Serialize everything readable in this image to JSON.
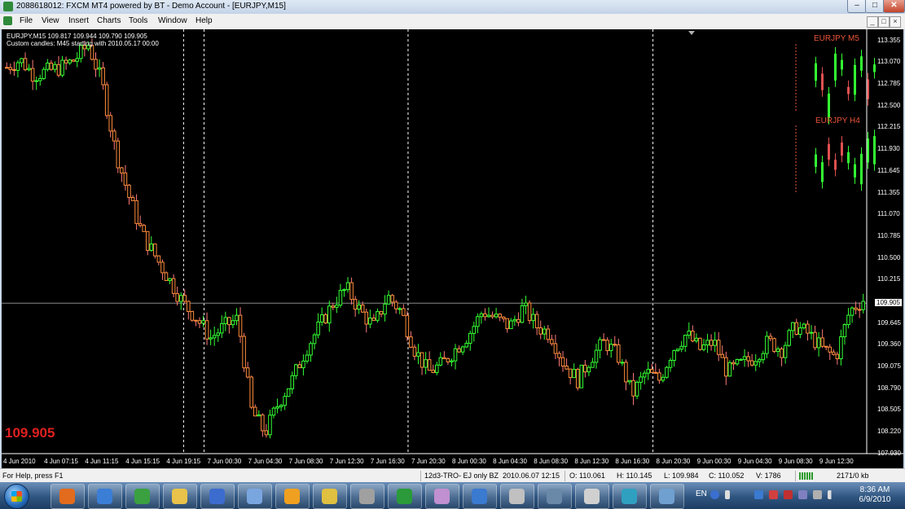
{
  "window": {
    "title": "2088618012: FXCM MT4 powered by BT - Demo Account - [EURJPY,M15]",
    "minimize": "–",
    "maximize": "□",
    "close": "✕"
  },
  "menu": [
    "File",
    "View",
    "Insert",
    "Charts",
    "Tools",
    "Window",
    "Help"
  ],
  "mdi_buttons": [
    "_",
    "□",
    "×"
  ],
  "chart": {
    "header_line1": "EURJPY,M15  109.817 109.944 109.790 109.905",
    "header_line2": "Custom candles: M45 starting with 2010.05.17 00:00",
    "big_price": "109.905",
    "current_price": "109.905",
    "price_levels": [
      "113.355",
      "113.070",
      "112.785",
      "112.500",
      "112.215",
      "111.930",
      "111.645",
      "111.355",
      "111.070",
      "110.785",
      "110.500",
      "110.215",
      "109.645",
      "109.360",
      "109.075",
      "108.790",
      "108.505",
      "108.220",
      "107.930"
    ],
    "time_labels": [
      "4 Jun 2010",
      "4 Jun 07:15",
      "4 Jun 11:15",
      "4 Jun 15:15",
      "4 Jun 19:15",
      "7 Jun 00:30",
      "7 Jun 04:30",
      "7 Jun 08:30",
      "7 Jun 12:30",
      "7 Jun 16:30",
      "7 Jun 20:30",
      "8 Jun 00:30",
      "8 Jun 04:30",
      "8 Jun 08:30",
      "8 Jun 12:30",
      "8 Jun 16:30",
      "8 Jun 20:30",
      "9 Jun 00:30",
      "9 Jun 04:30",
      "9 Jun 08:30",
      "9 Jun 12:30"
    ],
    "mini_m5_label": "EURJPY  M5",
    "mini_h4_label": "EURJPY  H4",
    "colors": {
      "bull": "#33ff33",
      "bear": "#ff7a7a",
      "bear_outline": "#ff8c3a",
      "grid": "#ffffff",
      "price_line": "#8a8a8a"
    }
  },
  "chart_data": {
    "type": "candlestick",
    "symbol": "EURJPY",
    "timeframe": "M15",
    "ylim": [
      107.93,
      113.5
    ],
    "current": 109.905,
    "session_breaks": [
      "4 Jun 19:15",
      "7 Jun 00:30",
      "7 Jun 20:30",
      "8 Jun 20:30"
    ],
    "close_path": [
      113.0,
      113.1,
      112.9,
      112.95,
      113.0,
      113.1,
      113.3,
      112.8,
      111.9,
      111.3,
      110.8,
      110.5,
      110.2,
      109.9,
      109.7,
      109.45,
      109.6,
      109.7,
      108.5,
      108.2,
      108.6,
      108.9,
      109.3,
      109.6,
      109.9,
      110.1,
      109.8,
      109.6,
      110.0,
      109.8,
      109.3,
      109.0,
      109.1,
      109.3,
      109.5,
      109.8,
      109.7,
      109.6,
      109.85,
      109.6,
      109.5,
      109.1,
      108.9,
      109.2,
      109.4,
      109.2,
      108.7,
      109.0,
      108.9,
      109.3,
      109.5,
      109.3,
      109.4,
      109.0,
      109.1,
      109.2,
      109.4,
      109.3,
      109.6,
      109.5,
      109.3,
      109.2,
      109.8,
      109.95
    ]
  },
  "status": {
    "help": "For Help, press F1",
    "profile": "12d3-TRO- EJ only BZ",
    "datetime": "2010.06.07 12:15",
    "open": "O: 110.061",
    "high": "H: 110.145",
    "low": "L: 109.984",
    "close": "C: 110.052",
    "volume": "V: 1786",
    "traffic": "2171/0 kb"
  },
  "taskbar": {
    "lang": "EN",
    "time": "8:36 AM",
    "date": "6/9/2010"
  }
}
